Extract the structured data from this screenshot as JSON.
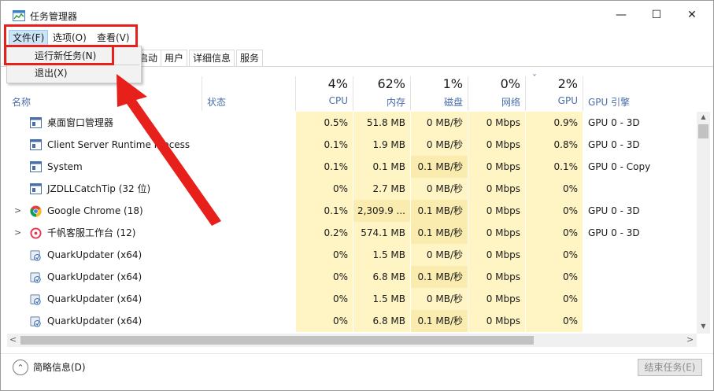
{
  "window": {
    "title": "任务管理器",
    "minimize": "—",
    "maximize": "☐",
    "close": "✕"
  },
  "menubar": [
    {
      "label": "文件(F)"
    },
    {
      "label": "选项(O)"
    },
    {
      "label": "查看(V)"
    }
  ],
  "file_menu": [
    {
      "label": "运行新任务(N)"
    },
    {
      "label": "退出(X)"
    }
  ],
  "tabs": [
    {
      "label": "启动"
    },
    {
      "label": "用户"
    },
    {
      "label": "详细信息"
    },
    {
      "label": "服务"
    }
  ],
  "columns": {
    "name": "名称",
    "status": "状态",
    "cpu": {
      "pct": "4%",
      "label": "CPU"
    },
    "memory": {
      "pct": "62%",
      "label": "内存"
    },
    "disk": {
      "pct": "1%",
      "label": "磁盘"
    },
    "network": {
      "pct": "0%",
      "label": "网络"
    },
    "gpu": {
      "pct": "2%",
      "label": "GPU"
    },
    "gpu_engine": "GPU 引擎",
    "sort_indicator": "ˇ"
  },
  "rows": [
    {
      "name": "桌面窗口管理器",
      "icon": "window-app-icon",
      "expand": "",
      "cpu": "0.5%",
      "mem": "51.8 MB",
      "disk": "0 MB/秒",
      "net": "0 Mbps",
      "gpu": "0.9%",
      "engine": "GPU 0 - 3D"
    },
    {
      "name": "Client Server Runtime Process",
      "icon": "window-app-icon",
      "expand": "",
      "cpu": "0.1%",
      "mem": "1.9 MB",
      "disk": "0 MB/秒",
      "net": "0 Mbps",
      "gpu": "0.8%",
      "engine": "GPU 0 - 3D"
    },
    {
      "name": "System",
      "icon": "window-app-icon",
      "expand": "",
      "cpu": "0.1%",
      "mem": "0.1 MB",
      "disk": "0.1 MB/秒",
      "net": "0 Mbps",
      "gpu": "0.1%",
      "engine": "GPU 0 - Copy"
    },
    {
      "name": "JZDLLCatchTip (32 位)",
      "icon": "window-app-icon",
      "expand": "",
      "cpu": "0%",
      "mem": "2.7 MB",
      "disk": "0 MB/秒",
      "net": "0 Mbps",
      "gpu": "0%",
      "engine": ""
    },
    {
      "name": "Google Chrome (18)",
      "icon": "chrome-icon",
      "expand": ">",
      "cpu": "0.1%",
      "mem": "2,309.9 ...",
      "disk": "0.1 MB/秒",
      "net": "0 Mbps",
      "gpu": "0%",
      "engine": "GPU 0 - 3D"
    },
    {
      "name": "千帆客服工作台 (12)",
      "icon": "qianfan-icon",
      "expand": ">",
      "cpu": "0.2%",
      "mem": "574.1 MB",
      "disk": "0.1 MB/秒",
      "net": "0 Mbps",
      "gpu": "0%",
      "engine": "GPU 0 - 3D"
    },
    {
      "name": "QuarkUpdater (x64)",
      "icon": "updater-icon",
      "expand": "",
      "cpu": "0%",
      "mem": "1.5 MB",
      "disk": "0 MB/秒",
      "net": "0 Mbps",
      "gpu": "0%",
      "engine": ""
    },
    {
      "name": "QuarkUpdater (x64)",
      "icon": "updater-icon",
      "expand": "",
      "cpu": "0%",
      "mem": "6.8 MB",
      "disk": "0.1 MB/秒",
      "net": "0 Mbps",
      "gpu": "0%",
      "engine": ""
    },
    {
      "name": "QuarkUpdater (x64)",
      "icon": "updater-icon",
      "expand": "",
      "cpu": "0%",
      "mem": "1.5 MB",
      "disk": "0 MB/秒",
      "net": "0 Mbps",
      "gpu": "0%",
      "engine": ""
    },
    {
      "name": "QuarkUpdater (x64)",
      "icon": "updater-icon",
      "expand": "",
      "cpu": "0%",
      "mem": "6.8 MB",
      "disk": "0.1 MB/秒",
      "net": "0 Mbps",
      "gpu": "0%",
      "engine": ""
    }
  ],
  "footer": {
    "fewer_details": "简略信息(D)",
    "end_task": "结束任务(E)",
    "collapse_icon": "⌃"
  },
  "scroll": {
    "up": "▲",
    "down": "▼",
    "left": "<",
    "right": ">"
  },
  "colors": {
    "highlight": "#e8201c",
    "cell_bg": "#fff4c4",
    "cell_bg_strong": "#f9ecae",
    "header_text": "#4a6ea8"
  }
}
